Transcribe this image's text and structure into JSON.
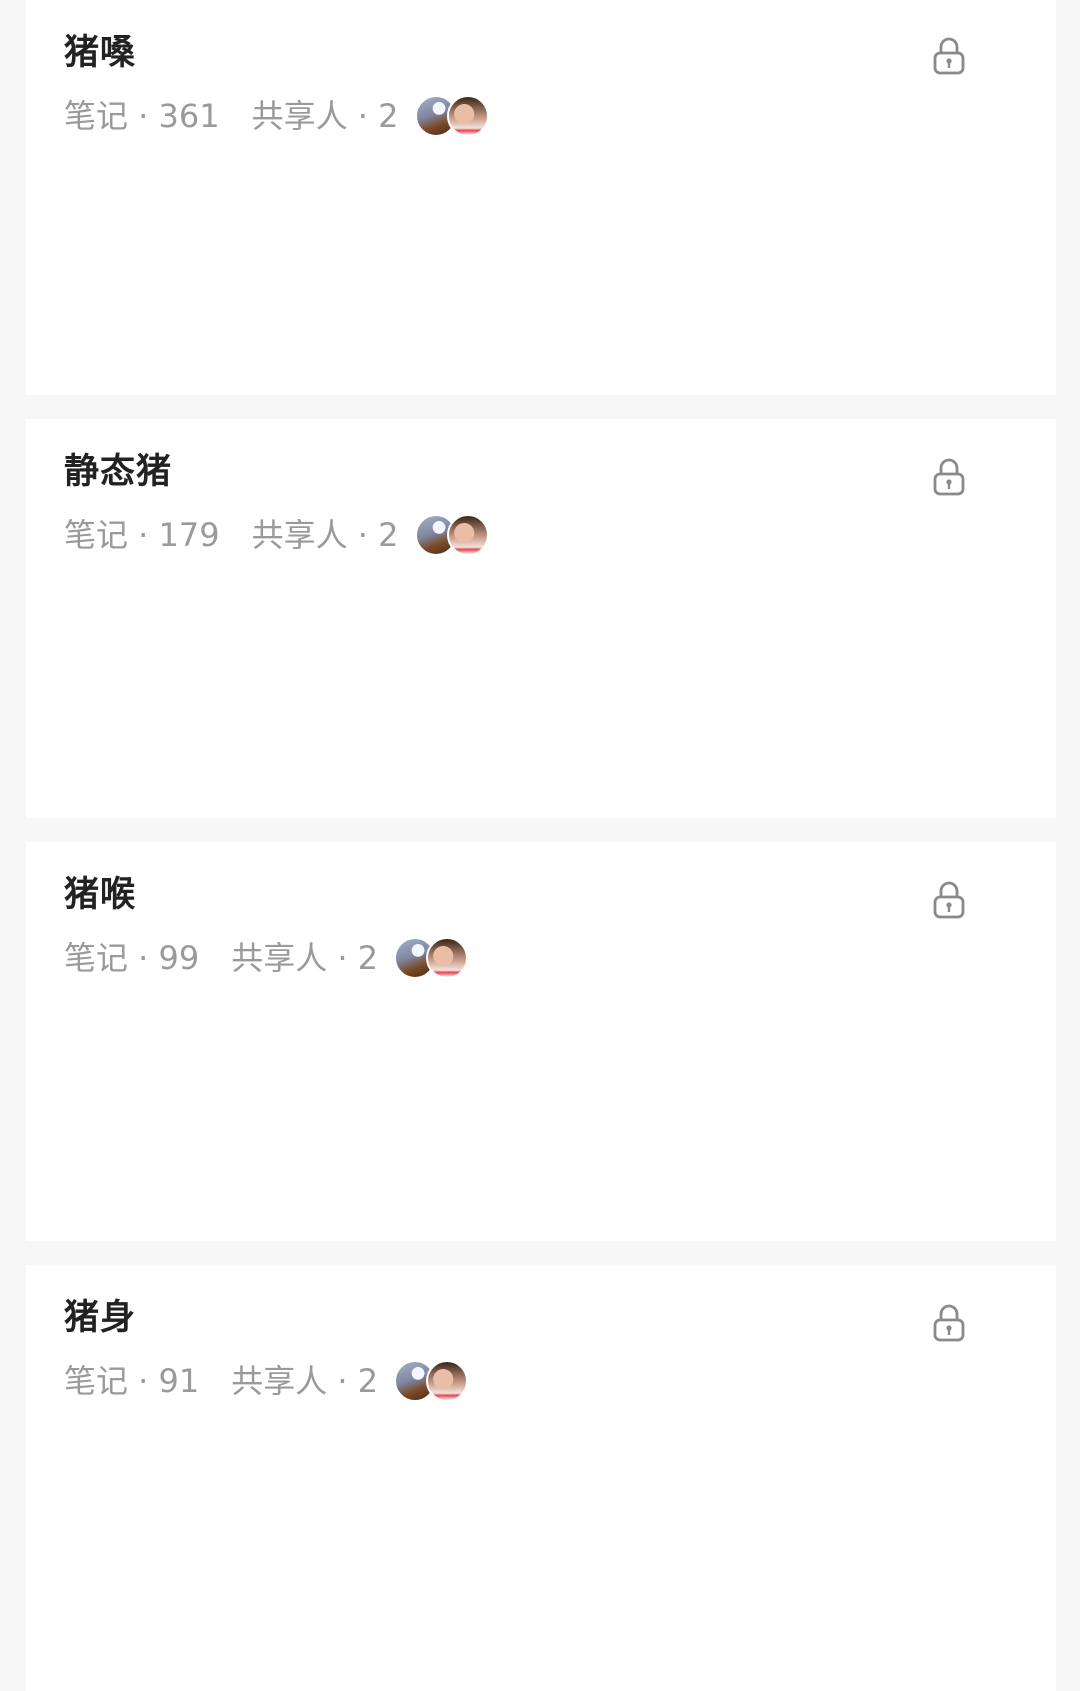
{
  "collections": [
    {
      "title": "猪嗓",
      "notes": "笔记 · 361",
      "sharers": "共享人 · 2",
      "avatars": [
        "shared-user-avatar",
        "shared-user-avatar"
      ],
      "status_icon": "lock-icon"
    },
    {
      "title": "静态猪",
      "notes": "笔记 · 179",
      "sharers": "共享人 · 2",
      "avatars": [
        "shared-user-avatar",
        "shared-user-avatar"
      ],
      "status_icon": "lock-icon"
    },
    {
      "title": "猪喉",
      "notes": "笔记 · 99",
      "sharers": "共享人 · 2",
      "avatars": [
        "shared-user-avatar",
        "shared-user-avatar"
      ],
      "status_icon": "lock-icon"
    },
    {
      "title": "猪身",
      "notes": "笔记 · 91",
      "sharers": "共享人 · 2",
      "avatars": [
        "shared-user-avatar",
        "shared-user-avatar"
      ],
      "status_icon": "lock-icon"
    }
  ],
  "colors": {
    "background": "#f7f7f7",
    "card": "#ffffff",
    "title_text": "#222222",
    "meta_text": "#9a9a9a",
    "lock_icon": "#8a8a8a"
  }
}
